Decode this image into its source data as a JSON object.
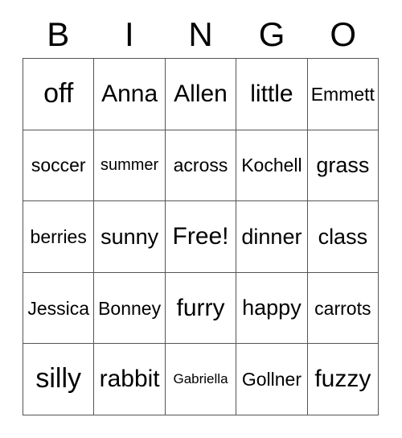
{
  "card": {
    "title": "BINGO",
    "header_letters": [
      "B",
      "I",
      "N",
      "G",
      "O"
    ],
    "free_space_label": "Free!",
    "colors": {
      "background": "#ffffff",
      "text": "#000000",
      "grid_line": "#555555"
    },
    "grid": {
      "columns": 5,
      "rows": 5,
      "cells": [
        [
          {
            "text": "off",
            "size": "fs-xxl"
          },
          {
            "text": "Anna",
            "size": "fs-xl"
          },
          {
            "text": "Allen",
            "size": "fs-xl"
          },
          {
            "text": "little",
            "size": "fs-xl"
          },
          {
            "text": "Emmett",
            "size": "fs-m"
          }
        ],
        [
          {
            "text": "soccer",
            "size": "fs-m"
          },
          {
            "text": "summer",
            "size": "fs-s"
          },
          {
            "text": "across",
            "size": "fs-m"
          },
          {
            "text": "Kochell",
            "size": "fs-m"
          },
          {
            "text": "grass",
            "size": "fs-l"
          }
        ],
        [
          {
            "text": "berries",
            "size": "fs-m"
          },
          {
            "text": "sunny",
            "size": "fs-l"
          },
          {
            "text": "Free!",
            "size": "fs-xl"
          },
          {
            "text": "dinner",
            "size": "fs-l"
          },
          {
            "text": "class",
            "size": "fs-l"
          }
        ],
        [
          {
            "text": "Jessica",
            "size": "fs-m"
          },
          {
            "text": "Bonney",
            "size": "fs-m"
          },
          {
            "text": "furry",
            "size": "fs-xl"
          },
          {
            "text": "happy",
            "size": "fs-l"
          },
          {
            "text": "carrots",
            "size": "fs-m"
          }
        ],
        [
          {
            "text": "silly",
            "size": "fs-xxl"
          },
          {
            "text": "rabbit",
            "size": "fs-xl"
          },
          {
            "text": "Gabriella",
            "size": "fs-xs"
          },
          {
            "text": "Gollner",
            "size": "fs-m"
          },
          {
            "text": "fuzzy",
            "size": "fs-xl"
          }
        ]
      ]
    }
  }
}
